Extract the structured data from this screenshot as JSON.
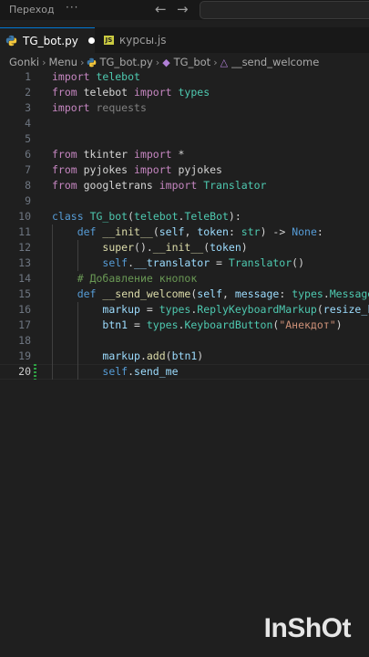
{
  "topbar": {
    "menu_label": "Переход",
    "more_label": "···",
    "back_icon": "arrow-left-icon",
    "forward_icon": "arrow-right-icon"
  },
  "tabs": [
    {
      "label": "TG_bot.py",
      "icon": "python-icon",
      "modified": true,
      "active": true
    },
    {
      "label": "курсы.js",
      "icon": "js-icon",
      "icon_text": "JS",
      "active": false
    }
  ],
  "breadcrumb": {
    "items": [
      "Gonki",
      "Menu",
      "TG_bot.py",
      "TG_bot",
      "__send_welcome"
    ],
    "separator": "›"
  },
  "editor": {
    "current_line": "20",
    "lines": [
      {
        "n": "1",
        "tokens": [
          [
            "kc",
            "import"
          ],
          [
            "op",
            " "
          ],
          [
            "t",
            "telebot"
          ]
        ]
      },
      {
        "n": "2",
        "tokens": [
          [
            "kc",
            "from"
          ],
          [
            "op",
            " telebot "
          ],
          [
            "kc",
            "import"
          ],
          [
            "op",
            " "
          ],
          [
            "t",
            "types"
          ]
        ]
      },
      {
        "n": "3",
        "tokens": [
          [
            "kc",
            "import"
          ],
          [
            "op",
            " "
          ],
          [
            "dim",
            "requests"
          ]
        ]
      },
      {
        "n": "4",
        "tokens": []
      },
      {
        "n": "5",
        "tokens": []
      },
      {
        "n": "6",
        "tokens": [
          [
            "kc",
            "from"
          ],
          [
            "op",
            " tkinter "
          ],
          [
            "kc",
            "import"
          ],
          [
            "op",
            " *"
          ]
        ]
      },
      {
        "n": "7",
        "tokens": [
          [
            "kc",
            "from"
          ],
          [
            "op",
            " pyjokes "
          ],
          [
            "kc",
            "import"
          ],
          [
            "op",
            " pyjokes"
          ]
        ]
      },
      {
        "n": "8",
        "tokens": [
          [
            "kc",
            "from"
          ],
          [
            "op",
            " googletrans "
          ],
          [
            "kc",
            "import"
          ],
          [
            "op",
            " "
          ],
          [
            "t",
            "Translator"
          ]
        ]
      },
      {
        "n": "9",
        "tokens": []
      },
      {
        "n": "10",
        "tokens": [
          [
            "k",
            "class"
          ],
          [
            "op",
            " "
          ],
          [
            "t",
            "TG_bot"
          ],
          [
            "op",
            "("
          ],
          [
            "t",
            "telebot"
          ],
          [
            "op",
            "."
          ],
          [
            "t",
            "TeleBot"
          ],
          [
            "op",
            "):"
          ]
        ]
      },
      {
        "n": "11",
        "tokens": [
          [
            "op",
            "    "
          ],
          [
            "k",
            "def"
          ],
          [
            "op",
            " "
          ],
          [
            "f",
            "__init__"
          ],
          [
            "op",
            "("
          ],
          [
            "v",
            "self"
          ],
          [
            "op",
            ", "
          ],
          [
            "v",
            "token"
          ],
          [
            "op",
            ": "
          ],
          [
            "t",
            "str"
          ],
          [
            "op",
            ") -> "
          ],
          [
            "k",
            "None"
          ],
          [
            "op",
            ":"
          ]
        ]
      },
      {
        "n": "12",
        "tokens": [
          [
            "op",
            "        "
          ],
          [
            "f",
            "super"
          ],
          [
            "op",
            "()."
          ],
          [
            "f",
            "__init__"
          ],
          [
            "op",
            "("
          ],
          [
            "v",
            "token"
          ],
          [
            "op",
            ")"
          ]
        ]
      },
      {
        "n": "13",
        "tokens": [
          [
            "op",
            "        "
          ],
          [
            "k",
            "self"
          ],
          [
            "op",
            "."
          ],
          [
            "v",
            "__translator"
          ],
          [
            "op",
            " = "
          ],
          [
            "t",
            "Translator"
          ],
          [
            "op",
            "()"
          ]
        ]
      },
      {
        "n": "14",
        "tokens": [
          [
            "op",
            "    "
          ],
          [
            "c",
            "# Добавление кнопок"
          ]
        ]
      },
      {
        "n": "15",
        "tokens": [
          [
            "op",
            "    "
          ],
          [
            "k",
            "def"
          ],
          [
            "op",
            " "
          ],
          [
            "f",
            "__send_welcome"
          ],
          [
            "op",
            "("
          ],
          [
            "v",
            "self"
          ],
          [
            "op",
            ", "
          ],
          [
            "v",
            "message"
          ],
          [
            "op",
            ": "
          ],
          [
            "t",
            "types"
          ],
          [
            "op",
            "."
          ],
          [
            "t",
            "Message"
          ]
        ]
      },
      {
        "n": "16",
        "tokens": [
          [
            "op",
            "        "
          ],
          [
            "v",
            "markup"
          ],
          [
            "op",
            " = "
          ],
          [
            "t",
            "types"
          ],
          [
            "op",
            "."
          ],
          [
            "t",
            "ReplyKeyboardMarkup"
          ],
          [
            "op",
            "("
          ],
          [
            "v",
            "resize_k"
          ]
        ]
      },
      {
        "n": "17",
        "tokens": [
          [
            "op",
            "        "
          ],
          [
            "v",
            "btn1"
          ],
          [
            "op",
            " = "
          ],
          [
            "t",
            "types"
          ],
          [
            "op",
            "."
          ],
          [
            "t",
            "KeyboardButton"
          ],
          [
            "op",
            "("
          ],
          [
            "s",
            "\"Анекдот\""
          ],
          [
            "op",
            ")"
          ]
        ]
      },
      {
        "n": "18",
        "tokens": []
      },
      {
        "n": "19",
        "tokens": [
          [
            "op",
            "        "
          ],
          [
            "v",
            "markup"
          ],
          [
            "op",
            "."
          ],
          [
            "f",
            "add"
          ],
          [
            "op",
            "("
          ],
          [
            "v",
            "btn1"
          ],
          [
            "op",
            ")"
          ]
        ]
      },
      {
        "n": "20",
        "tokens": [
          [
            "op",
            "        "
          ],
          [
            "k",
            "self"
          ],
          [
            "op",
            "."
          ],
          [
            "v",
            "send_me"
          ]
        ]
      }
    ]
  },
  "watermark": {
    "text": "InShOt"
  }
}
